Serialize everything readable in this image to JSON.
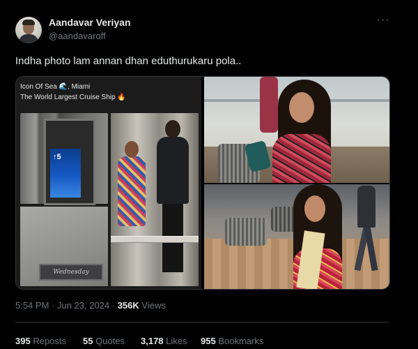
{
  "author": {
    "display_name": "Aandavar Veriyan",
    "handle": "@aandavaroff",
    "avatar_icon": "avatar-photo"
  },
  "more_icon": "more-options-icon",
  "tweet": {
    "text": "Indha photo lam annan dhan eduthurukaru pola.."
  },
  "media": {
    "caption_line1_pre": "Icon Of Sea",
    "caption_line1_wave": "🌊",
    "caption_line1_post": ", Miami",
    "caption_line2": "The World Largest Cruise Ship",
    "caption_line2_icon": "🔥",
    "elevator_screen": "↑5",
    "floor_mat_text": "Wednesday"
  },
  "meta": {
    "time": "5:54 PM · Jun 23, 2024 · ",
    "views_count": "356K",
    "views_label": " Views"
  },
  "stats": {
    "reposts_count": "395",
    "reposts_label": "Reposts",
    "quotes_count": "55",
    "quotes_label": "Quotes",
    "likes_count": "3,178",
    "likes_label": "Likes",
    "bookmarks_count": "955",
    "bookmarks_label": "Bookmarks"
  },
  "colors": {
    "background": "#000000",
    "primary_text": "#e7e9ea",
    "secondary_text": "#71767b",
    "border": "#2f3336"
  }
}
